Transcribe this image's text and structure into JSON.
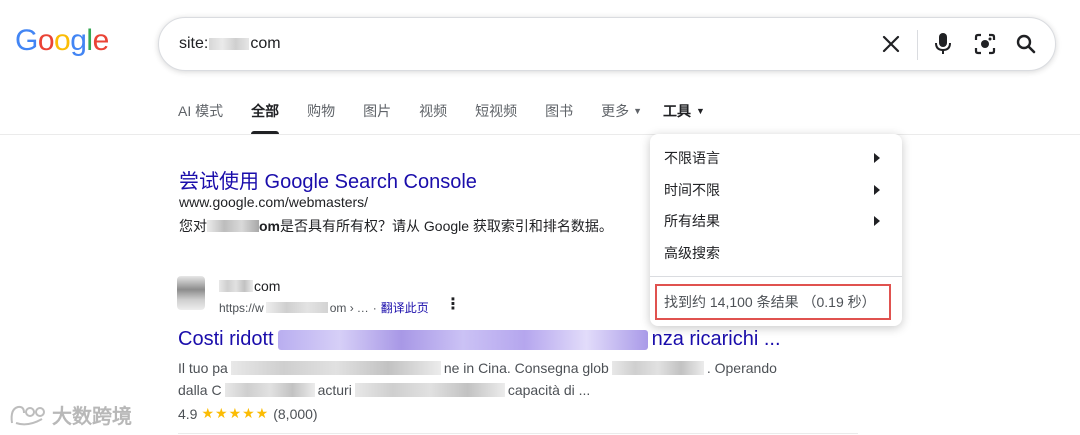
{
  "logo": {
    "text": "Google",
    "letters": [
      {
        "ch": "G",
        "color": "#4285F4"
      },
      {
        "ch": "o",
        "color": "#EA4335"
      },
      {
        "ch": "o",
        "color": "#FBBC05"
      },
      {
        "ch": "g",
        "color": "#4285F4"
      },
      {
        "ch": "l",
        "color": "#34A853"
      },
      {
        "ch": "e",
        "color": "#EA4335"
      }
    ]
  },
  "search": {
    "query_prefix": "site:",
    "query_suffix": "com"
  },
  "tabs": [
    {
      "label": "AI 模式"
    },
    {
      "label": "全部"
    },
    {
      "label": "购物"
    },
    {
      "label": "图片"
    },
    {
      "label": "视频"
    },
    {
      "label": "短视频"
    },
    {
      "label": "图书"
    },
    {
      "label": "更多"
    }
  ],
  "tools_label": "工具",
  "result1": {
    "title": "尝试使用 Google Search Console",
    "url": "www.google.com/webmasters/",
    "desc_prefix": "您对",
    "desc_domain_suffix": "om",
    "desc_rest": " 是否具有所有权？请从 Google 获取索引和排名数据。"
  },
  "result2": {
    "site_suffix": "com",
    "url_prefix": "https://w",
    "url_suffix": "om ›",
    "url_tail": "…",
    "translate": "翻译此页",
    "title_prefix": "Costi ridott",
    "title_suffix": "nza ricarichi ...",
    "desc1_prefix": "Il tuo pa",
    "desc1_mid": "ne in Cina. Consegna glob",
    "desc1_suffix": ". Operando",
    "desc2_prefix": "dalla C",
    "desc2_mid": "acturi",
    "desc2_suffix": "capacità di ...",
    "rating_value": "4.9",
    "stars": "★★★★★",
    "rating_count": "(8,000)"
  },
  "tools_menu": {
    "items": [
      {
        "label": "不限语言",
        "has_submenu": true
      },
      {
        "label": "时间不限",
        "has_submenu": true
      },
      {
        "label": "所有结果",
        "has_submenu": true
      },
      {
        "label": "高级搜索",
        "has_submenu": false
      }
    ],
    "stats": "找到约 14,100 条结果 （0.19 秒）",
    "highlight_color": "#e0524f"
  },
  "watermark": "大数跨境"
}
